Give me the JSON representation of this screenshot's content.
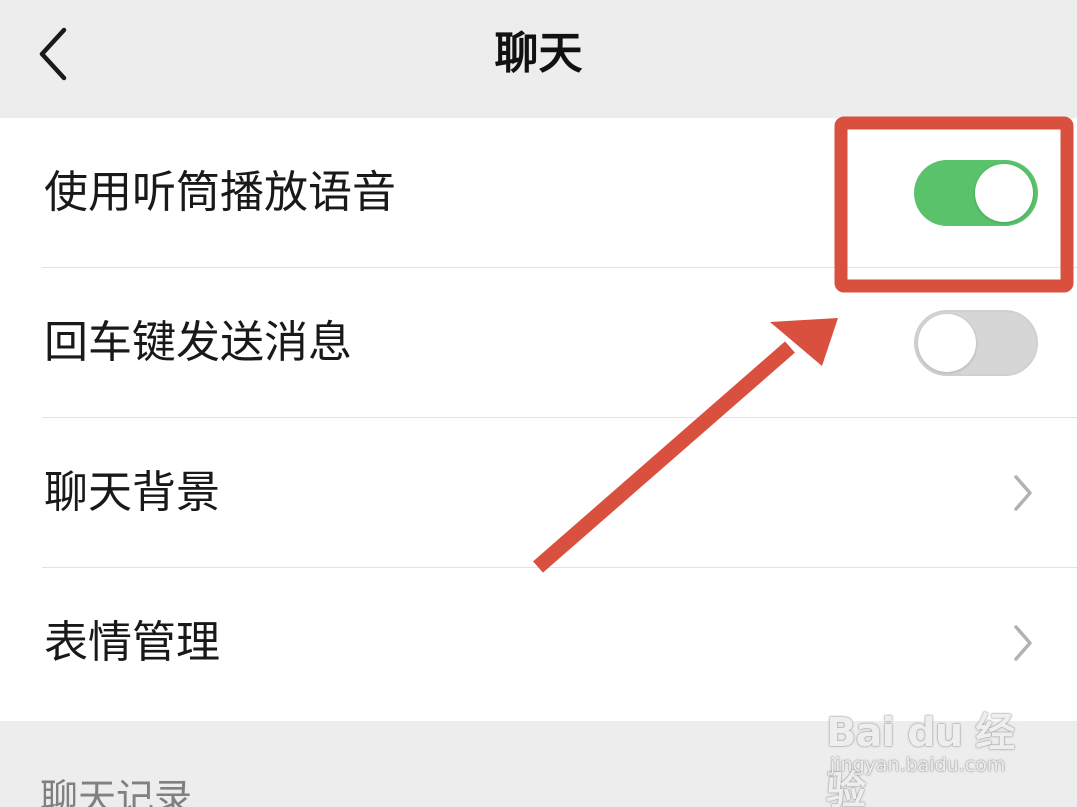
{
  "nav": {
    "title": "聊天",
    "back_icon": "chevron-left-icon"
  },
  "settings": {
    "rows": [
      {
        "label": "使用听筒播放语音",
        "control": "toggle",
        "toggle_on": true
      },
      {
        "label": "回车键发送消息",
        "control": "toggle",
        "toggle_on": false
      },
      {
        "label": "聊天背景",
        "control": "chevron-right-icon"
      },
      {
        "label": "表情管理",
        "control": "chevron-right-icon"
      }
    ]
  },
  "section_header": "聊天记录",
  "colors": {
    "toggle_on": "#5ac26b",
    "toggle_off": "#d6d6d6",
    "annotation_red": "#d9503f",
    "background": "#ededed"
  },
  "watermark": {
    "brand": "Bai du 经验",
    "url": "jingyan.baidu.com"
  }
}
